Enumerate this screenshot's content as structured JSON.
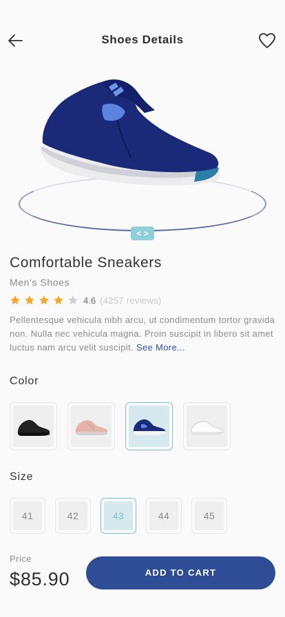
{
  "header": {
    "title": "Shoes Details"
  },
  "product": {
    "name": "Comfortable Sneakers",
    "category": "Men's Shoes",
    "rating": "4.6",
    "rating_stars": 4,
    "reviews": "(4257 reviews)",
    "description": "Pellentesque vehicula nibh arcu, ut condimentum tortor gravida non. Nulla nec vehicula magna. Proin suscipit in libero sit amet luctus nam arcu velit suscipit.",
    "see_more": "See More..."
  },
  "swipe": {
    "label": "< >"
  },
  "color": {
    "label": "Color",
    "options": [
      {
        "icon": "black-sneaker-icon"
      },
      {
        "icon": "pink-sneaker-icon"
      },
      {
        "icon": "navy-sneaker-icon",
        "selected": true
      },
      {
        "icon": "white-sneaker-icon"
      }
    ]
  },
  "size": {
    "label": "Size",
    "options": [
      "41",
      "42",
      "43",
      "44",
      "45"
    ],
    "selected": "43"
  },
  "footer": {
    "price_label": "Price",
    "price": "$85.90",
    "cart_label": "ADD TO CART"
  },
  "colors": {
    "accent": "#2f4d96",
    "selected": "#7fc0ce",
    "star": "#f5a623"
  }
}
